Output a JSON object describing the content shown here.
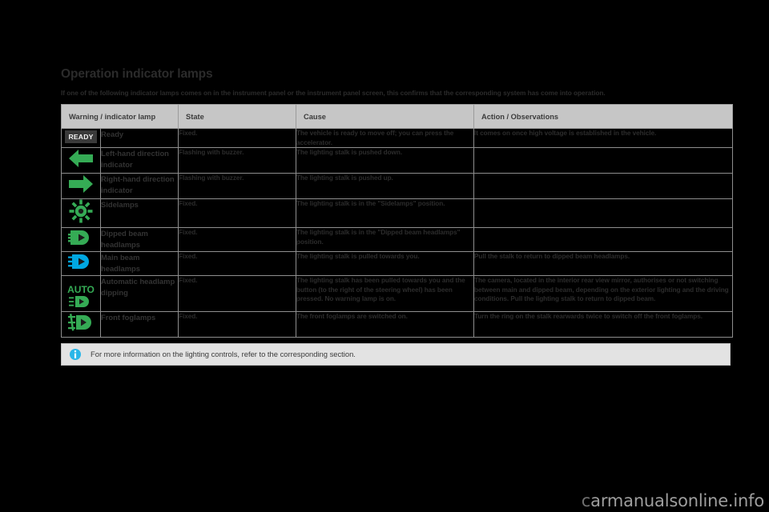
{
  "document": {
    "title": "Operation indicator lamps",
    "subtitle": "If one of the following indicator lamps comes on in the instrument panel or the instrument panel screen, this confirms that the corresponding system has come into operation."
  },
  "table": {
    "headers": {
      "lamp": "Warning / indicator lamp",
      "state": "State",
      "cause": "Cause",
      "action": "Action / Observations"
    },
    "rows": [
      {
        "icon": "ready-badge-icon",
        "icon_label": "READY",
        "icon_color": "#f2f2f2",
        "name": "Ready",
        "state": "Fixed.",
        "cause": "The vehicle is ready to move off; you can press the accelerator.",
        "action": "It comes on once high voltage is established in the vehicle."
      },
      {
        "icon": "arrow-left-icon",
        "icon_label": "",
        "icon_color": "#35ab55",
        "name": "Left-hand direction indicator",
        "state": "Flashing with buzzer.",
        "cause": "The lighting stalk is pushed down.",
        "action": ""
      },
      {
        "icon": "arrow-right-icon",
        "icon_label": "",
        "icon_color": "#35ab55",
        "name": "Right-hand direction indicator",
        "state": "Flashing with buzzer.",
        "cause": "The lighting stalk is pushed up.",
        "action": ""
      },
      {
        "icon": "sidelamps-icon",
        "icon_label": "",
        "icon_color": "#35ab55",
        "name": "Sidelamps",
        "state": "Fixed.",
        "cause": "The lighting stalk is in the \"Sidelamps\" position.",
        "action": ""
      },
      {
        "icon": "dipped-beam-icon",
        "icon_label": "",
        "icon_color": "#35ab55",
        "name": "Dipped beam headlamps",
        "state": "Fixed.",
        "cause": "The lighting stalk is in the \"Dipped beam headlamps\" position.",
        "action": ""
      },
      {
        "icon": "main-beam-icon",
        "icon_label": "",
        "icon_color": "#00a7e1",
        "name": "Main beam headlamps",
        "state": "Fixed.",
        "cause": "The lighting stalk is pulled towards you.",
        "action": "Pull the stalk to return to dipped beam headlamps."
      },
      {
        "icon": "auto-headlamp-dipping-icon",
        "icon_label": "AUTO",
        "icon_color": "#35ab55",
        "name": "Automatic headlamp dipping",
        "state": "Fixed.",
        "cause": "The lighting stalk has been pulled towards you and the button (to the right of the steering wheel) has been pressed. No warning lamp is on.",
        "action": "The camera, located in the interior rear view mirror, authorises or not switching between main and dipped beam, depending on the exterior lighting and the driving conditions. Pull the lighting stalk to return to dipped beam."
      },
      {
        "icon": "front-foglamps-icon",
        "icon_label": "",
        "icon_color": "#35ab55",
        "name": "Front foglamps",
        "state": "Fixed.",
        "cause": "The front foglamps are switched on.",
        "action": "Turn the ring on the stalk rearwards twice to switch off the front foglamps."
      }
    ]
  },
  "footnote": {
    "icon": "info-icon",
    "text": "For more information on the lighting controls, refer to the corresponding section."
  },
  "watermark": {
    "prefix": "c",
    "text": "armanualsonline.info"
  },
  "colors": {
    "green": "#35ab55",
    "blue": "#00a7e1",
    "header_bg": "#c6c6c6",
    "name_bg": "#e0e0e0",
    "footnote_bg": "#e3e3e3"
  }
}
